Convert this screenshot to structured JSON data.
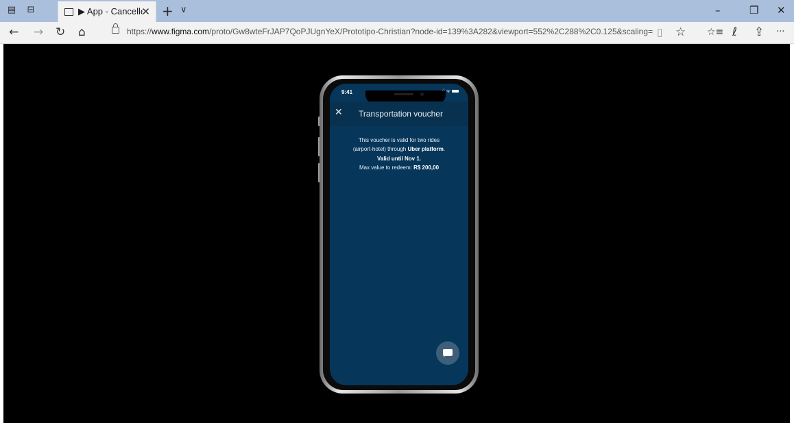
{
  "browser": {
    "tab": {
      "title": "▶ App - Cancelled - Prc",
      "close_glyph": "✕"
    },
    "new_tab_glyph": "+",
    "tab_list_glyph": "∨",
    "window_controls": {
      "minimize": "–",
      "restore": "❐",
      "close": "✕"
    },
    "nav": {
      "back": "←",
      "forward": "→",
      "refresh": "↻",
      "home": "⌂",
      "reading_view": "▯",
      "favorite": "☆",
      "favorites_list": "☆≡",
      "notes": "ℓ",
      "share": "⇪",
      "more": "···"
    },
    "url_prefix": "https://",
    "url_domain": "www.figma.com",
    "url_path": "/proto/Gw8wteFrJAP7QoPJUgnYeX/Prototipo-Christian?node-id=139%3A282&viewport=552%2C288%2C0.125&scaling=scale-down%"
  },
  "phone": {
    "status_time": "9:41",
    "status_icons": ".ıl ᯤ",
    "header": {
      "close_glyph": "✕",
      "title": "Transportation voucher"
    },
    "voucher": {
      "line1": "This voucher is valid for two rides",
      "line2_prefix": "(airport-hotel) through ",
      "line2_bold": "Uber platform",
      "line2_suffix": ".",
      "valid_until": "Valid until Nov 1.",
      "max_value_prefix": "Max value to redeem: ",
      "max_value_amount": "R$ 200,00"
    }
  },
  "colors": {
    "screen_bg": "#06365a",
    "header_bg": "#08314f",
    "fab_bg": "#3d5f79",
    "chrome_tabbar": "#a9bfdc"
  },
  "icons": [
    "tab-actions-icon",
    "set-aside-icon",
    "page-icon",
    "close-icon",
    "plus-icon",
    "chevron-down-icon",
    "back-icon",
    "forward-icon",
    "refresh-icon",
    "home-icon",
    "lock-icon",
    "reading-view-icon",
    "star-icon",
    "favorites-icon",
    "pen-icon",
    "share-icon",
    "more-icon",
    "chat-icon"
  ]
}
